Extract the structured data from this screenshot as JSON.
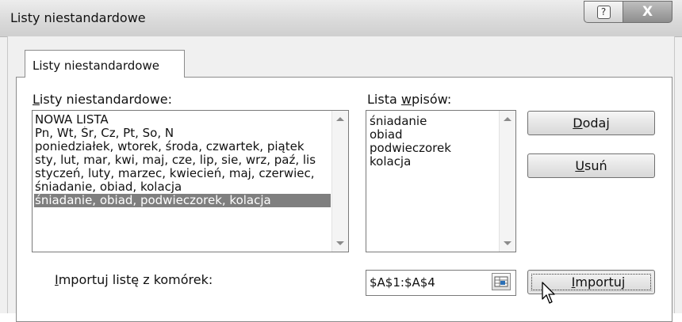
{
  "window": {
    "title": "Listy niestandardowe",
    "help_glyph": "?",
    "close_glyph": "X"
  },
  "tab": {
    "label": "Listy niestandardowe"
  },
  "custom_lists": {
    "label_accel": "L",
    "label_rest": "isty niestandardowe:",
    "items": [
      "NOWA LISTA",
      "Pn, Wt, Śr, Cz, Pt, So, N",
      "poniedziałek, wtorek, środa, czwartek, piątek",
      "sty, lut, mar, kwi, maj, cze, lip, sie, wrz, paź, lis",
      "styczeń, luty, marzec, kwiecień, maj, czerwiec,",
      "śniadanie, obiad, kolacja",
      "śniadanie, obiad, podwieczorek, kolacja"
    ],
    "selected_index": 6
  },
  "entries": {
    "label_pre": "Lista ",
    "label_accel": "w",
    "label_post": "pisów:",
    "items": [
      "śniadanie",
      "obiad",
      "podwieczorek",
      "kolacja"
    ]
  },
  "buttons": {
    "add_accel": "D",
    "add_rest": "odaj",
    "delete_accel": "U",
    "delete_rest": "suń",
    "import_accel": "I",
    "import_rest": "mportuj"
  },
  "import": {
    "label_accel": "I",
    "label_rest": "mportuj listę z komórek:",
    "range_value": "$A$1:$A$4"
  },
  "icons": {
    "help": "help-icon",
    "close": "close-icon",
    "range_picker": "range-picker-icon",
    "cursor": "mouse-pointer-icon"
  },
  "colors": {
    "selection_bg": "#7f7f7f",
    "close_button": "#9a9a9a",
    "dialog_bg": "#f0f0f0"
  }
}
